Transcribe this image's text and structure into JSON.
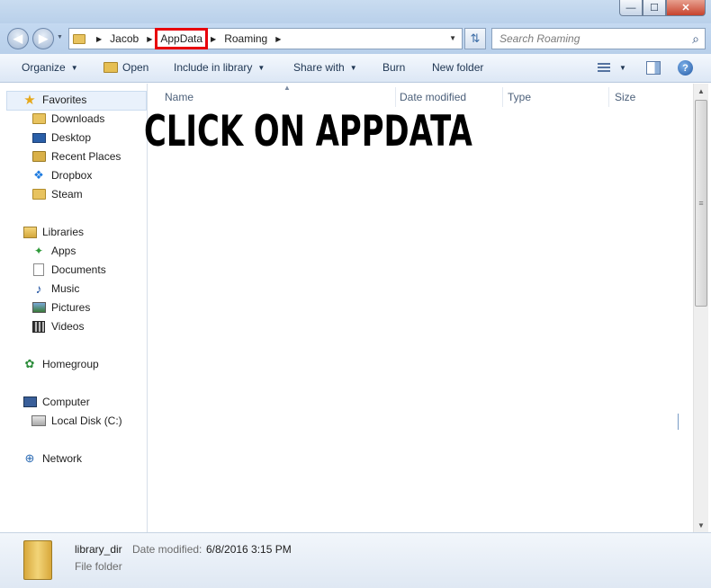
{
  "window": {
    "minimize": "—",
    "maximize": "☐",
    "close": "✕"
  },
  "address": {
    "crumbs": [
      "Jacob",
      "AppData",
      "Roaming"
    ],
    "highlighted": "AppData",
    "highlight_color": "#e8000b"
  },
  "search": {
    "placeholder": "Search Roaming"
  },
  "toolbar": {
    "organize": "Organize",
    "open": "Open",
    "include": "Include in library",
    "share": "Share with",
    "burn": "Burn",
    "new_folder": "New folder"
  },
  "nav": {
    "favorites": "Favorites",
    "downloads": "Downloads",
    "desktop": "Desktop",
    "recent": "Recent Places",
    "dropbox": "Dropbox",
    "steam": "Steam",
    "libraries": "Libraries",
    "apps": "Apps",
    "documents": "Documents",
    "music": "Music",
    "pictures": "Pictures",
    "videos": "Videos",
    "homegroup": "Homegroup",
    "computer": "Computer",
    "local_disk": "Local Disk (C:)",
    "network": "Network"
  },
  "columns": {
    "name": "Name",
    "date": "Date modified",
    "type": "Type",
    "size": "Size"
  },
  "overlay": "CLICK ON APPDATA",
  "details": {
    "name": "library_dir",
    "date_label": "Date modified:",
    "date_value": "6/8/2016 3:15 PM",
    "type": "File folder"
  }
}
